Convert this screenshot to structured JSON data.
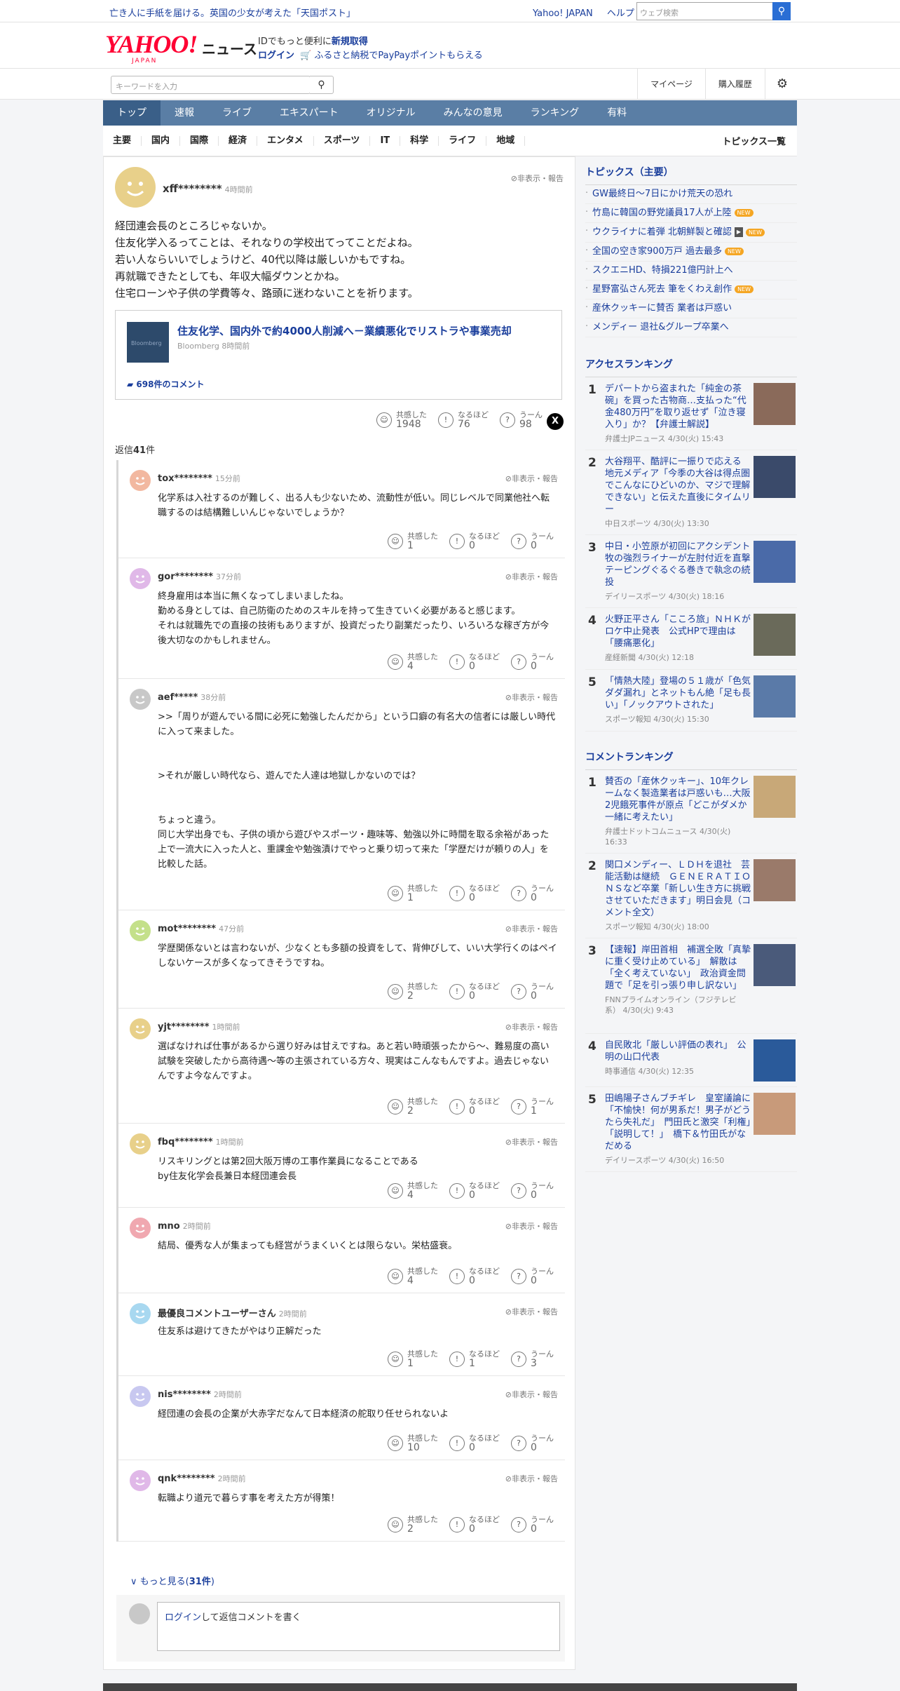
{
  "topbar": {
    "promo": "亡き人に手紙を届ける。英国の少女が考えた「天国ポスト」",
    "links": [
      "Yahoo! JAPAN",
      "ヘルプ"
    ],
    "search_placeholder": "ウェブ検索"
  },
  "header": {
    "logo": "YAHOO!",
    "logo_sub": "JAPAN",
    "news": "ニュース",
    "id_prefix": "IDでもっと便利に",
    "id_link": "新規取得",
    "login": "ログイン",
    "furusato": "ふるさと納税でPayPayポイントもらえる"
  },
  "searchrow": {
    "placeholder": "キーワードを入力",
    "mypage": "マイページ",
    "history": "購入履歴"
  },
  "gnav": [
    "トップ",
    "速報",
    "ライブ",
    "エキスパート",
    "オリジナル",
    "みんなの意見",
    "ランキング",
    "有料"
  ],
  "cnav": [
    "主要",
    "国内",
    "国際",
    "経済",
    "エンタメ",
    "スポーツ",
    "IT",
    "科学",
    "ライフ",
    "地域"
  ],
  "topics_all": "トピックス一覧",
  "post": {
    "user": "xff********",
    "time": "4時間前",
    "hide": "非表示・報告",
    "lines": [
      "経団連会長のところじゃないか。",
      "住友化学入るってことは、それなりの学校出てってことだよね。",
      "若い人ならいいでしょうけど、40代以降は厳しいかもですね。",
      "再就職できたとしても、年収大幅ダウンとかね。",
      "住宅ローンや子供の学費等々、路頭に迷わないことを祈ります。"
    ],
    "article": {
      "title": "住友化学、国内外で約4000人削減へ－業績悪化でリストラや事業売却",
      "source": "Bloomberg 8時間前",
      "thumb": "Bloomberg",
      "comments": "698件のコメント"
    },
    "reactions": [
      {
        "label": "共感した",
        "count": "1948"
      },
      {
        "label": "なるほど",
        "count": "76"
      },
      {
        "label": "うーん",
        "count": "98"
      }
    ],
    "x": "X",
    "reply_prefix": "返信",
    "reply_count": "41",
    "reply_suffix": "件"
  },
  "reactions_labels": [
    "共感した",
    "なるほど",
    "うーん"
  ],
  "replies": [
    {
      "user": "tox********",
      "time": "15分前",
      "color": "#f2b8a0",
      "text": "化学系は入社するのが難しく、出る人も少ないため、流動性が低い。同じレベルで同業他社へ転職するのは結構難しいんじゃないでしょうか？",
      "counts": [
        "1",
        "0",
        "0"
      ]
    },
    {
      "user": "gor********",
      "time": "37分前",
      "color": "#e0b8e8",
      "text": "終身雇用は本当に無くなってしまいましたね。\n勤める身としては、自己防衛のためのスキルを持って生きていく必要があると感じます。\nそれは就職先での直接の技術もありますが、投資だったり副業だったり、いろいろな稼ぎ方が今後大切なのかもしれません。",
      "counts": [
        "4",
        "0",
        "0"
      ]
    },
    {
      "user": "aef*****",
      "time": "38分前",
      "color": "#c8c8c8",
      "text": ">>「周りが遊んでいる間に必死に勉強したんだから」という口癖の有名大の信者には厳しい時代に入って来ました。\n\n\n>それが厳しい時代なら、遊んでた人達は地獄しかないのでは？\n\n\nちょっと違う。\n同じ大学出身でも、子供の頃から遊びやスポーツ・趣味等、勉強以外に時間を取る余裕があった上で一流大に入った人と、重課金や勉強漬けでやっと乗り切って来た「学歴だけが頼りの人」を比較した話。",
      "counts": [
        "1",
        "0",
        "0"
      ]
    },
    {
      "user": "mot********",
      "time": "47分前",
      "color": "#c4e08a",
      "text": "学歴関係ないとは言わないが、少なくとも多額の投資をして、背伸びして、いい大学行くのはペイしないケースが多くなってきそうですね。",
      "counts": [
        "2",
        "0",
        "0"
      ]
    },
    {
      "user": "yjt********",
      "time": "1時間前",
      "color": "#e8d08a",
      "text": "選ばなければ仕事があるから選り好みは甘えですね。あと若い時頑張ったから〜、難易度の高い試験を突破したから高待遇〜等の主張されている方々、現実はこんなもんですよ。過去じゃないんですよ今なんですよ。",
      "counts": [
        "2",
        "0",
        "1"
      ]
    },
    {
      "user": "fbq********",
      "time": "1時間前",
      "color": "#e8d08a",
      "text": "リスキリングとは第2回大阪万博の工事作業員になることである\nby住友化学会長兼日本経団連会長",
      "counts": [
        "4",
        "0",
        "0"
      ]
    },
    {
      "user": "mno",
      "time": "2時間前",
      "color": "#f0a8b0",
      "text": "結局、優秀な人が集まっても経営がうまくいくとは限らない。栄枯盛衰。",
      "counts": [
        "4",
        "0",
        "0"
      ]
    },
    {
      "user": "最優良コメントユーザーさん",
      "time": "2時間前",
      "color": "#a8d8f0",
      "text": "住友系は避けてきたがやはり正解だった",
      "counts": [
        "1",
        "1",
        "3"
      ]
    },
    {
      "user": "nis********",
      "time": "2時間前",
      "color": "#c8c8f0",
      "text": "経団連の会長の企業が大赤字だなんて日本経済の舵取り任せられないよ",
      "counts": [
        "10",
        "0",
        "0"
      ]
    },
    {
      "user": "qnk********",
      "time": "2時間前",
      "color": "#e0b8e8",
      "text": "転職より道元で暮らす事を考えた方が得策！",
      "counts": [
        "2",
        "0",
        "0"
      ]
    }
  ],
  "more": {
    "prefix": "もっと見る(",
    "count": "31件",
    "suffix": ")"
  },
  "comment_box": {
    "login": "ログイン",
    "rest": "して返信コメントを書く"
  },
  "sidebar": {
    "topics_title": "トピックス（主要）",
    "topics": [
      {
        "text": "GW最終日〜7日にかけ荒天の恐れ",
        "badge": ""
      },
      {
        "text": "竹島に韓国の野党議員17人が上陸",
        "badge": "NEW"
      },
      {
        "text": "ウクライナに着弾 北朝鮮製と確認",
        "badge": "NEW",
        "cam": "▶"
      },
      {
        "text": "全国の空き家900万戸 過去最多",
        "badge": "NEW"
      },
      {
        "text": "スクエニHD、特損221億円計上へ",
        "badge": ""
      },
      {
        "text": "星野富弘さん死去 筆をくわえ創作",
        "badge": "NEW"
      },
      {
        "text": "産休クッキーに賛否 業者は戸惑い",
        "badge": ""
      },
      {
        "text": "メンディー 退社&グループ卒業へ",
        "badge": ""
      }
    ],
    "access_title": "アクセスランキング",
    "access": [
      {
        "n": "1",
        "title": "デパートから盗まれた「純金の茶碗」を買った古物商…支払った“代金480万円”を取り返せず「泣き寝入り」か？【弁護士解説】",
        "src": "弁護士JPニュース 4/30(火) 15:43",
        "thumb": "#8a6a5a"
      },
      {
        "n": "2",
        "title": "大谷翔平、酷評に一振りで応える 地元メディア「今季の大谷は得点圏でこんなにひどいのか、マジで理解できない」と伝えた直後にタイムリー",
        "src": "中日スポーツ 4/30(火) 13:30",
        "thumb": "#3a4a6a"
      },
      {
        "n": "3",
        "title": "中日・小笠原が初回にアクシデント　牧の強烈ライナーが左肘付近を直撃　テーピングぐるぐる巻きで執念の続投",
        "src": "デイリースポーツ 4/30(火) 18:16",
        "thumb": "#4a6aa8"
      },
      {
        "n": "4",
        "title": "火野正平さん「こころ旅」ＮＨＫがロケ中止発表　公式HPで理由は「腰痛悪化」",
        "src": "産経新聞 4/30(火) 12:18",
        "thumb": "#6a6a5a"
      },
      {
        "n": "5",
        "title": "「情熱大陸」登場の５１歳が「色気ダダ漏れ」とネットもん絶「足も長い」「ノックアウトされた」",
        "src": "スポーツ報知 4/30(火) 15:30",
        "thumb": "#5a7aa8"
      }
    ],
    "comment_title": "コメントランキング",
    "comments": [
      {
        "n": "1",
        "title": "賛否の「産休クッキー」、10年クレームなく製造業者は戸惑いも…大阪2児餓死事件が原点「どこがダメか一緒に考えたい」",
        "src": "弁護士ドットコムニュース 4/30(火) 16:33",
        "thumb": "#c8a878"
      },
      {
        "n": "2",
        "title": "関口メンディー、ＬＤＨを退社　芸能活動は継続　ＧＥＮＥＲＡＴＩＯＮＳなど卒業「新しい生き方に挑戦させていただきます」明日会見（コメント全文）",
        "src": "スポーツ報知 4/30(火) 18:00",
        "thumb": "#9a7a6a"
      },
      {
        "n": "3",
        "title": "【速報】岸田首相　補選全敗「真摯に重く受け止めている」　解散は「全く考えていない」　政治資金問題で「足を引っ張り申し訳ない」",
        "src": "FNNプライムオンライン（フジテレビ系） 4/30(火) 9:43",
        "thumb": "#4a5a7a"
      },
      {
        "n": "4",
        "title": "自民敗北「厳しい評価の表れ」　公明の山口代表",
        "src": "時事通信 4/30(火) 12:35",
        "thumb": "#2a5a9a"
      },
      {
        "n": "5",
        "title": "田嶋陽子さんブチギレ　皇室議論に「不愉快！何が男系だ！男子がどうたら失礼だ」　門田氏と激突「利権」「説明して！」　橋下＆竹田氏がなだめる",
        "src": "デイリースポーツ 4/30(火) 16:50",
        "thumb": "#c89a7a"
      }
    ]
  }
}
